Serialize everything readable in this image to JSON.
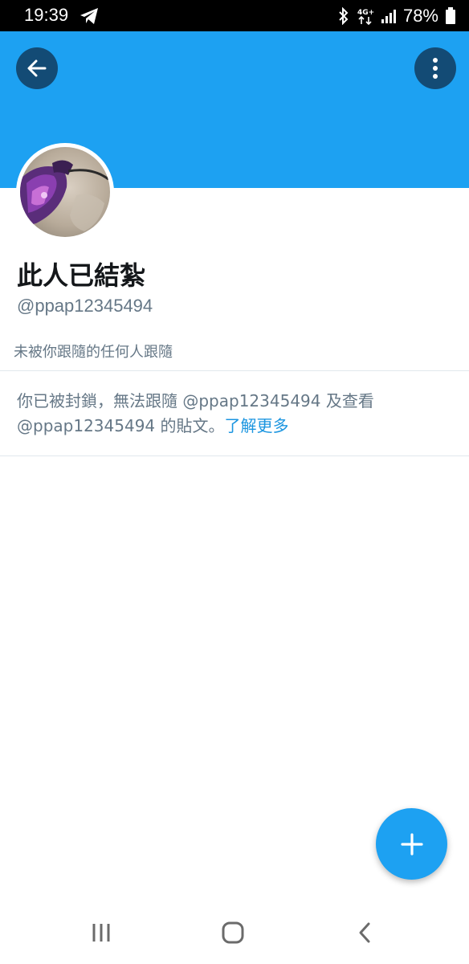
{
  "status_bar": {
    "time": "19:39",
    "battery_text": "78%",
    "icons": [
      "telegram-icon",
      "bluetooth-icon",
      "4g-icon",
      "signal-icon",
      "battery-icon"
    ]
  },
  "colors": {
    "banner": "#1da1f2",
    "accent": "#1da1f2",
    "link": "#1b95e0",
    "text_secondary": "#657786"
  },
  "header": {
    "back_icon": "arrow-left-icon",
    "more_icon": "more-vertical-icon"
  },
  "profile": {
    "display_name": "此人已結紮",
    "handle": "@ppap12345494",
    "follow_note": "未被你跟隨的任何人跟隨"
  },
  "blocked_notice": {
    "message": "你已被封鎖，無法跟隨 @ppap12345494 及查看 @ppap12345494 的貼文。",
    "learn_more": "了解更多"
  },
  "fab": {
    "icon": "plus-icon"
  },
  "nav_bar": {
    "icons": [
      "recents-icon",
      "home-icon",
      "back-icon"
    ]
  }
}
